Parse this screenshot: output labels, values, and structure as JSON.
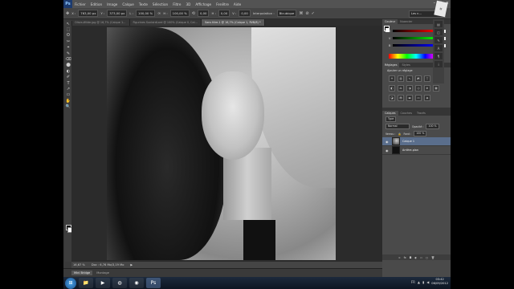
{
  "menubar": {
    "logo": "Ps",
    "items": [
      "Fichier",
      "Edition",
      "Image",
      "Calque",
      "Texte",
      "Sélection",
      "Filtre",
      "3D",
      "Affichage",
      "Fenêtre",
      "Aide"
    ]
  },
  "options": {
    "x_value": "763,00 px",
    "y_value": "373,00 px",
    "w_value": "100,00 %",
    "h_value": "100,00 %",
    "angle": "0,00",
    "skew_h": "0,00",
    "skew_v": "0,00",
    "interpolation_label": "Interpolation :",
    "interpolation_value": "Bicubique",
    "workspace": "Les n…"
  },
  "doc_tabs": [
    {
      "label": "Olivia-Wilde.jpg @ 16,7% (Calque 1…",
      "active": false
    },
    {
      "label": "Figurines SunbirdLard @ 100% (Calque 0, Cal…",
      "active": false
    },
    {
      "label": "Sans titre-1 @ 16,7% (Calque 1, RVB/8) *",
      "active": true
    }
  ],
  "tools": [
    "↖",
    "⬚",
    "ʘ",
    "✂",
    "⌖",
    "✎",
    "⌫",
    "⬤",
    "◐",
    "✐",
    "T",
    "↗",
    "▭",
    "✋",
    "🔍"
  ],
  "statusbar": {
    "zoom": "16,67 %",
    "doc": "Doc : 6,76 Mo/3,19 Mo"
  },
  "bottom_tabs": [
    {
      "label": "Mini Bridge",
      "active": true
    },
    {
      "label": "Montage",
      "active": false
    }
  ],
  "color_panel": {
    "tabs": [
      "Couleur",
      "Nuancier"
    ],
    "r_label": "R",
    "g_label": "V",
    "b_label": "B",
    "r": "0",
    "g": "0",
    "b": "0"
  },
  "adjust_panel": {
    "tabs": [
      "Réglages",
      "Styles"
    ],
    "title": "Ajouter un réglage"
  },
  "layers_panel": {
    "tabs": [
      "Calques",
      "Couches",
      "Tracés"
    ],
    "kind": "Type",
    "blend": "Normal",
    "opacity_label": "Opacité :",
    "opacity": "100 %",
    "lock_label": "Verrou :",
    "fill_label": "Fond :",
    "fill": "100 %",
    "layers": [
      {
        "name": "Calque 1",
        "selected": true
      },
      {
        "name": "Arrière-plan",
        "selected": false
      }
    ]
  },
  "taskbar": {
    "tray_lang": "FR",
    "time": "03:42",
    "date": "06/09/2012"
  }
}
